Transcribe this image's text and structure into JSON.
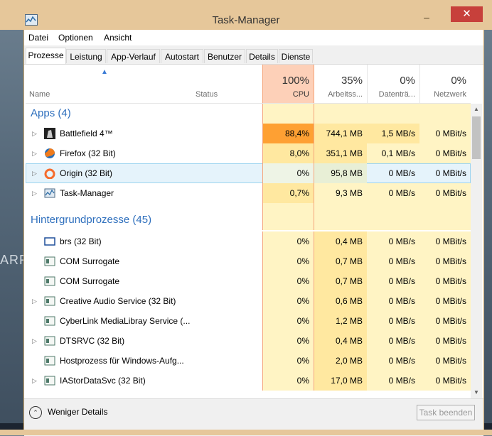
{
  "window": {
    "title": "Task-Manager",
    "minimize": "–",
    "maximize": "☐",
    "close": "✕"
  },
  "background": {
    "text": "ARR"
  },
  "menu": [
    "Datei",
    "Optionen",
    "Ansicht"
  ],
  "tabs": [
    "Prozesse",
    "Leistung",
    "App-Verlauf",
    "Autostart",
    "Benutzer",
    "Details",
    "Dienste"
  ],
  "active_tab": "Prozesse",
  "columns": {
    "name": "Name",
    "status": "Status",
    "cpu": {
      "pct": "100%",
      "label": "CPU"
    },
    "memory": {
      "pct": "35%",
      "label": "Arbeitss..."
    },
    "disk": {
      "pct": "0%",
      "label": "Datenträ..."
    },
    "network": {
      "pct": "0%",
      "label": "Netzwerk"
    }
  },
  "groups": {
    "apps": "Apps (4)",
    "background": "Hintergrundprozesse (45)"
  },
  "apps": [
    {
      "name": "Battlefield 4™",
      "cpu": "88,4%",
      "mem": "744,1 MB",
      "disk": "1,5 MB/s",
      "net": "0 MBit/s",
      "icon": "battlefield-icon",
      "expandable": true
    },
    {
      "name": "Firefox (32 Bit)",
      "cpu": "8,0%",
      "mem": "351,1 MB",
      "disk": "0,1 MB/s",
      "net": "0 MBit/s",
      "icon": "firefox-icon",
      "expandable": true
    },
    {
      "name": "Origin (32 Bit)",
      "cpu": "0%",
      "mem": "95,8 MB",
      "disk": "0 MB/s",
      "net": "0 MBit/s",
      "icon": "origin-icon",
      "expandable": true,
      "selected": true
    },
    {
      "name": "Task-Manager",
      "cpu": "0,7%",
      "mem": "9,3 MB",
      "disk": "0 MB/s",
      "net": "0 MBit/s",
      "icon": "task-manager-icon",
      "expandable": true
    }
  ],
  "background_processes": [
    {
      "name": "brs (32 Bit)",
      "cpu": "0%",
      "mem": "0,4 MB",
      "disk": "0 MB/s",
      "net": "0 MBit/s",
      "icon": "window-icon",
      "expandable": false
    },
    {
      "name": "COM Surrogate",
      "cpu": "0%",
      "mem": "0,7 MB",
      "disk": "0 MB/s",
      "net": "0 MBit/s",
      "icon": "service-icon",
      "expandable": false
    },
    {
      "name": "COM Surrogate",
      "cpu": "0%",
      "mem": "0,7 MB",
      "disk": "0 MB/s",
      "net": "0 MBit/s",
      "icon": "service-icon",
      "expandable": false
    },
    {
      "name": "Creative Audio Service (32 Bit)",
      "cpu": "0%",
      "mem": "0,6 MB",
      "disk": "0 MB/s",
      "net": "0 MBit/s",
      "icon": "service-icon",
      "expandable": true
    },
    {
      "name": "CyberLink MediaLibray Service (...",
      "cpu": "0%",
      "mem": "1,2 MB",
      "disk": "0 MB/s",
      "net": "0 MBit/s",
      "icon": "service-icon",
      "expandable": false
    },
    {
      "name": "DTSRVC (32 Bit)",
      "cpu": "0%",
      "mem": "0,4 MB",
      "disk": "0 MB/s",
      "net": "0 MBit/s",
      "icon": "service-icon",
      "expandable": true
    },
    {
      "name": "Hostprozess für Windows-Aufg...",
      "cpu": "0%",
      "mem": "2,0 MB",
      "disk": "0 MB/s",
      "net": "0 MBit/s",
      "icon": "service-icon",
      "expandable": false
    },
    {
      "name": "IAStorDataSvc (32 Bit)",
      "cpu": "0%",
      "mem": "17,0 MB",
      "disk": "0 MB/s",
      "net": "0 MBit/s",
      "icon": "service-icon",
      "expandable": true
    }
  ],
  "footer": {
    "fewer_details": "Weniger Details",
    "end_task": "Task beenden"
  }
}
